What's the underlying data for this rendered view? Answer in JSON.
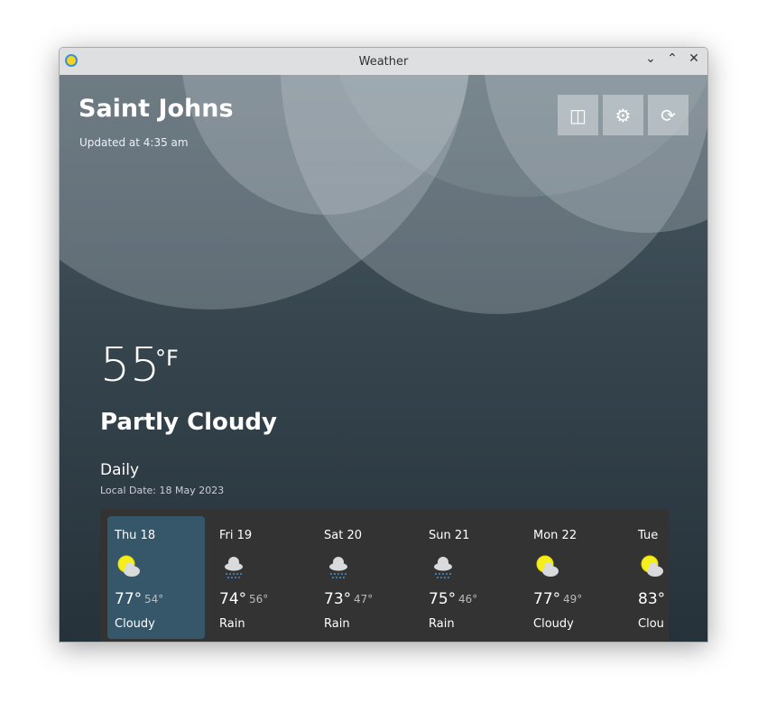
{
  "window": {
    "title": "Weather"
  },
  "header": {
    "city": "Saint Johns",
    "updated": "Updated at 4:35 am"
  },
  "current": {
    "temperature": "55",
    "unit": "°F",
    "condition": "Partly Cloudy"
  },
  "daily": {
    "heading": "Daily",
    "local_date": "Local Date: 18 May 2023",
    "days": [
      {
        "label": "Thu 18",
        "icon": "partly-cloudy-icon",
        "high": "77°",
        "low": "54°",
        "condition": "Cloudy",
        "selected": true
      },
      {
        "label": "Fri 19",
        "icon": "rain-icon",
        "high": "74°",
        "low": "56°",
        "condition": "Rain"
      },
      {
        "label": "Sat 20",
        "icon": "rain-icon",
        "high": "73°",
        "low": "47°",
        "condition": "Rain"
      },
      {
        "label": "Sun 21",
        "icon": "rain-icon",
        "high": "75°",
        "low": "46°",
        "condition": "Rain"
      },
      {
        "label": "Mon 22",
        "icon": "partly-cloudy-icon",
        "high": "77°",
        "low": "49°",
        "condition": "Cloudy"
      },
      {
        "label": "Tue",
        "icon": "partly-cloudy-icon",
        "high": "83°",
        "low": "",
        "condition": "Clou"
      }
    ]
  },
  "colors": {
    "selected_day": "#36566a",
    "card": "#333333"
  }
}
